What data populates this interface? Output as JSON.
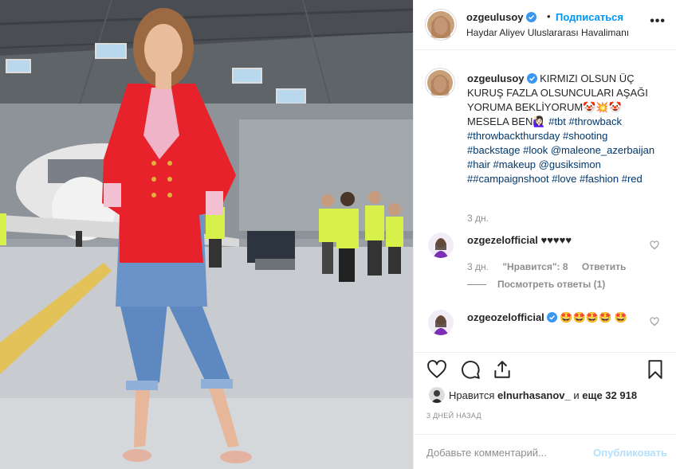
{
  "post": {
    "username": "ozgeulusoy",
    "separator": "•",
    "follow_label": "Подписаться",
    "location": "Haydar Aliyev Uluslararası Havalimanı",
    "more_label": "•••"
  },
  "caption": {
    "username": "ozgeulusoy",
    "text": " KIRMIZI OLSUN ÜÇ KURUŞ FAZLA OLSUNCULARI AŞAĞI YORUMA BEKLİYORUM🤡💥🤡 MESELA BEN🙋🏻‍♀️ ",
    "hashtags": [
      "#tbt",
      "#throwback",
      "#throwbackthursday",
      "#shooting",
      "#backstage",
      "#look",
      "@maleone_azerbaijan",
      "#hair",
      "#makeup",
      "@gusiksimon",
      "##campaignshoot",
      "#love",
      "#fashion",
      "#red"
    ],
    "time": "3 дн."
  },
  "comments": [
    {
      "username": "ozgezelofficial",
      "text": "♥♥♥♥♥",
      "time": "3 дн.",
      "likes": "\"Нравится\": 8",
      "reply_label": "Ответить",
      "replies_label": "Посмотреть ответы (1)"
    },
    {
      "username": "ozgeozelofficial",
      "text": "🤩🤩🤩🤩 🤩"
    }
  ],
  "likes": {
    "prefix": "Нравится ",
    "user": "elnurhasanov_",
    "middle": " и ",
    "count": "еще 32 918"
  },
  "posted_ago": "3 ДНЕЙ НАЗАД",
  "add_comment": {
    "placeholder": "Добавьте комментарий...",
    "publish_label": "Опубликовать"
  },
  "icons": {
    "like": "heart-icon",
    "comment": "comment-icon",
    "share": "share-icon",
    "save": "bookmark-icon",
    "verified": "verified-badge-icon"
  },
  "colors": {
    "accent": "#0095f6",
    "link": "#00376b",
    "muted": "#8e8e8e",
    "jacket": "#e8222b"
  }
}
